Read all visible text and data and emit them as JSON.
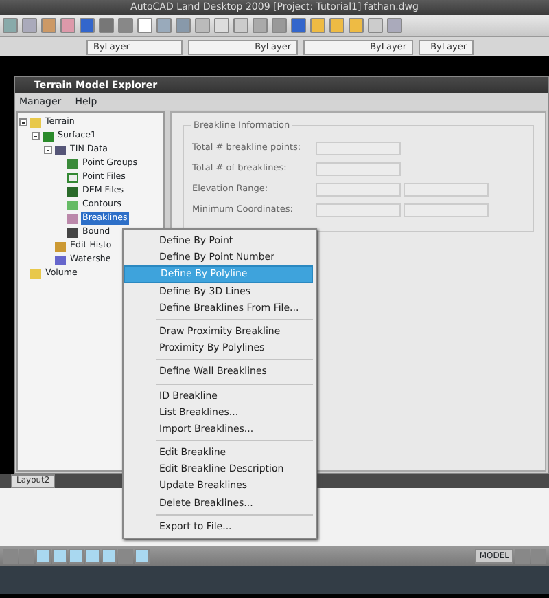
{
  "window": {
    "title": "AutoCAD Land Desktop 2009 [Project: Tutorial1] fathan.dwg"
  },
  "properties_bar": [
    "ByLayer",
    "ByLayer",
    "ByLayer",
    "ByLayer"
  ],
  "dialog": {
    "title": "Terrain Model Explorer",
    "menu": [
      "Manager",
      "Help"
    ],
    "tree": [
      {
        "label": "Terrain",
        "expanded": true,
        "selected": false,
        "children": [
          {
            "label": "Surface1",
            "expanded": true,
            "selected": false,
            "children": [
              {
                "label": "TIN Data",
                "expanded": true,
                "selected": false,
                "children": [
                  {
                    "label": "Point Groups",
                    "selected": false
                  },
                  {
                    "label": "Point Files",
                    "selected": false
                  },
                  {
                    "label": "DEM Files",
                    "selected": false
                  },
                  {
                    "label": "Contours",
                    "selected": false
                  },
                  {
                    "label": "Breaklines",
                    "selected": true
                  },
                  {
                    "label": "Bound",
                    "selected": false
                  }
                ]
              },
              {
                "label": "Edit Histo",
                "selected": false
              },
              {
                "label": "Watershe",
                "selected": false
              }
            ]
          }
        ]
      },
      {
        "label": "Volume",
        "selected": false
      }
    ],
    "group_title": "Breakline Information",
    "fields": [
      "Total # breakline points:",
      "Total # of breaklines:",
      "Elevation Range:",
      "Minimum Coordinates:"
    ]
  },
  "context_menu": [
    [
      {
        "label": "Define By Point",
        "selected": false
      },
      {
        "label": "Define By Point Number",
        "selected": false
      },
      {
        "label": "Define By Polyline",
        "selected": true
      },
      {
        "label": "Define By 3D Lines",
        "selected": false
      },
      {
        "label": "Define Breaklines From File...",
        "selected": false
      }
    ],
    [
      {
        "label": "Draw Proximity Breakline",
        "selected": false
      },
      {
        "label": "Proximity By Polylines",
        "selected": false
      }
    ],
    [
      {
        "label": "Define Wall Breaklines",
        "selected": false
      }
    ],
    [
      {
        "label": "ID Breakline",
        "selected": false
      },
      {
        "label": "List Breaklines...",
        "selected": false
      },
      {
        "label": "Import Breaklines...",
        "selected": false
      }
    ],
    [
      {
        "label": "Edit Breakline",
        "selected": false
      },
      {
        "label": "Edit Breakline Description",
        "selected": false
      },
      {
        "label": "Update Breaklines",
        "selected": false
      },
      {
        "label": "Delete Breaklines...",
        "selected": false
      }
    ],
    [
      {
        "label": "Export to File...",
        "selected": false
      }
    ]
  ],
  "layout_tab": "Layout2",
  "status_bar": {
    "mode": "MODEL",
    "toggles": [
      {
        "on": false
      },
      {
        "on": false
      },
      {
        "on": true
      },
      {
        "on": true
      },
      {
        "on": true
      },
      {
        "on": true
      },
      {
        "on": true
      },
      {
        "on": false
      },
      {
        "on": true
      }
    ]
  }
}
